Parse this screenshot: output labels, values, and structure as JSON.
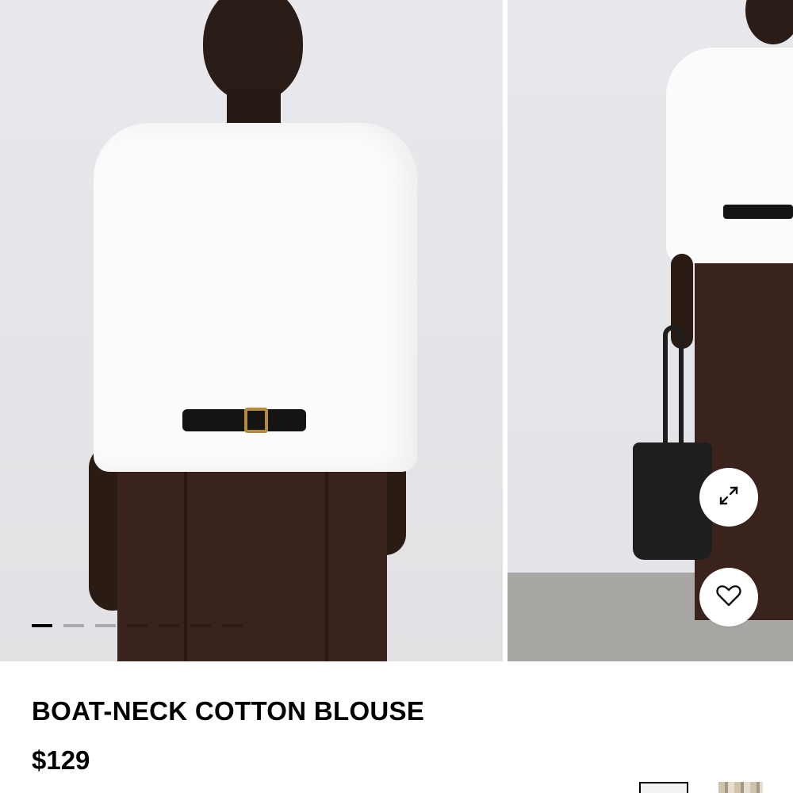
{
  "gallery": {
    "images": [
      {
        "name": "model-front-photo"
      },
      {
        "name": "model-full-length-photo"
      }
    ],
    "pager": {
      "count": 7,
      "active_index": 0
    },
    "expand_icon": "expand-arrows-icon",
    "favorite_icon": "heart-icon"
  },
  "product": {
    "title": "BOAT-NECK COTTON BLOUSE",
    "price": "$129"
  },
  "swatches": [
    {
      "color": "#f3f3f3",
      "selected": true
    },
    {
      "color": "#cdbfa6",
      "selected": false
    }
  ]
}
